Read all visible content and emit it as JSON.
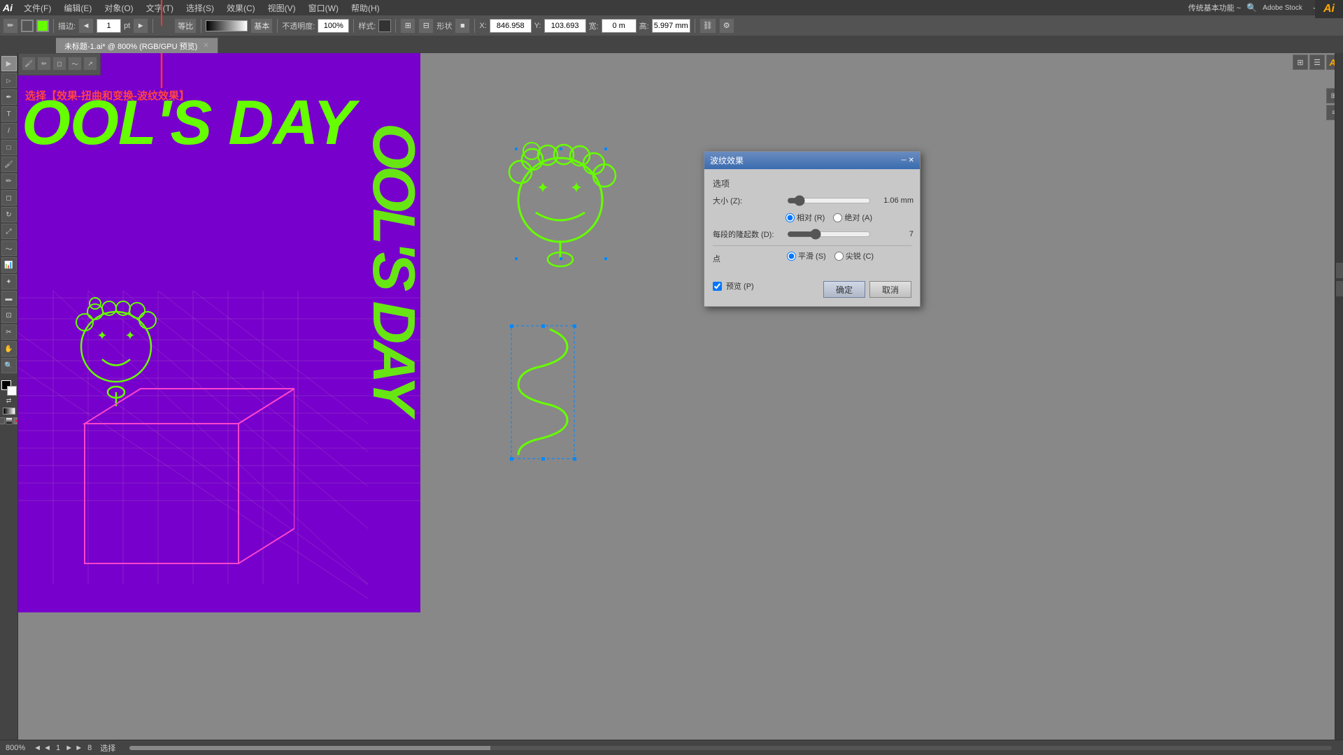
{
  "app": {
    "logo": "Ai",
    "title": "未标题-1.ai* @ 800% (RGB/GPU 预览)",
    "zoom": "800%",
    "mode": "RGB/GPU 预览"
  },
  "menu": {
    "items": [
      "文件(F)",
      "编辑(E)",
      "对象(O)",
      "文字(T)",
      "选择(S)",
      "效果(C)",
      "视图(V)",
      "窗口(W)",
      "帮助(H)"
    ]
  },
  "toolbar": {
    "stroke_width": "1",
    "stroke_unit": "pt",
    "equal_label": "等比",
    "base_label": "基本",
    "opacity_label": "不透明度:",
    "opacity_value": "100%",
    "style_label": "样式:",
    "shape_label": "形状",
    "x_label": "X:",
    "x_value": "846.958",
    "y_label": "Y:",
    "y_value": "103.693",
    "w_label": "宽:",
    "w_value": "0 m",
    "h_label": "高:",
    "h_value": "5.997 mm"
  },
  "tabs": [
    {
      "label": "未标题-1.ai* @ 800% (RGB/GPU 预览)",
      "active": true
    }
  ],
  "instruction": "选择【效果-扭曲和变换-波纹效果】",
  "wave_dialog": {
    "title": "波纹效果",
    "section_options": "选项",
    "size_label": "大小 (Z):",
    "size_value": "1.06 mm",
    "relative_label": "相对 (R)",
    "absolute_label": "绝对 (A)",
    "segments_label": "每段的隆起数 (D):",
    "segments_value": "7",
    "points_label": "点",
    "smooth_label": "平滑 (S)",
    "corner_label": "尖锐 (C)",
    "preview_label": "预览 (P)",
    "ok_label": "确定",
    "cancel_label": "取消"
  },
  "status_bar": {
    "zoom": "800%",
    "page_info": "1",
    "page_total": "8",
    "tool_label": "选择"
  },
  "top_right": {
    "panel_label": "传统基本功能 ~"
  }
}
